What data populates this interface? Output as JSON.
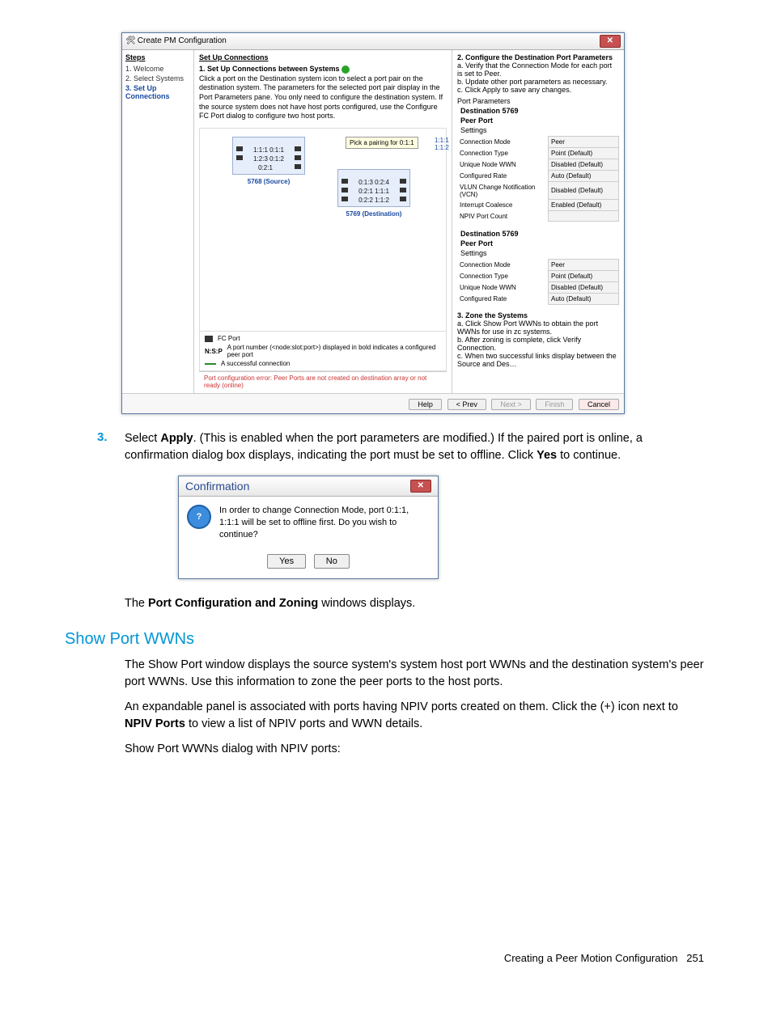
{
  "dialog1": {
    "title": "Create PM Configuration",
    "steps_header": "Steps",
    "steps": [
      "1. Welcome",
      "2. Select Systems",
      "3. Set Up Connections"
    ],
    "main_header": "Set Up Connections",
    "instr_bold": "1. Set Up Connections between Systems",
    "instr_text": "Click a port on the Destination system icon to select a port pair on the destination system. The parameters for the selected port pair display in the Port Parameters pane. You only need to configure the destination system. If the source system does not have host ports configured, use the Configure FC Port dialog to configure two host ports.",
    "source_ports": [
      "1:1:1  0:1:1",
      "1:2:3  0:1:2",
      "0:2:1"
    ],
    "source_caption": "5768 (Source)",
    "dest_ports": [
      "0:1:3  0:2:4",
      "0:2:1  1:1:1",
      "0:2:2  1:1:2"
    ],
    "dest_caption": "5769 (Destination)",
    "tooltip": "Pick a pairing for 0:1:1",
    "pairlist": [
      "1:1:1",
      "1:1:2"
    ],
    "legend1_label": "FC Port",
    "legend2_prefix": "N:S:P",
    "legend2_text": "A port number (<node:slot:port>) displayed in bold indicates a configured peer port",
    "legend3_text": "A successful connection",
    "right_bold": "2. Configure the Destination Port Parameters",
    "right_steps": [
      "a. Verify that the Connection Mode for each port is set to Peer.",
      "b. Update other port parameters as necessary.",
      "c. Click Apply to save any changes."
    ],
    "params_hdr": "Port Parameters",
    "dest_line": "Destination  5769",
    "peer_line": "Peer Port",
    "settings": "Settings",
    "rows1": [
      [
        "Connection Mode",
        "Peer"
      ],
      [
        "Connection Type",
        "Point (Default)"
      ],
      [
        "Unique Node WWN",
        "Disabled (Default)"
      ],
      [
        "Configured Rate",
        "Auto (Default)"
      ],
      [
        "VLUN Change Notification (VCN)",
        "Disabled (Default)"
      ],
      [
        "Interrupt Coalesce",
        "Enabled (Default)"
      ],
      [
        "NPIV Port Count",
        ""
      ]
    ],
    "rows2": [
      [
        "Connection Mode",
        "Peer"
      ],
      [
        "Connection Type",
        "Point (Default)"
      ],
      [
        "Unique Node WWN",
        "Disabled (Default)"
      ],
      [
        "Configured Rate",
        "Auto (Default)"
      ]
    ],
    "zone_bold": "3. Zone the Systems",
    "zone_steps": [
      "a. Click Show Port WWNs to obtain the port WWNs for use in zc systems.",
      "b. After zoning is complete, click Verify Connection.",
      "c. When two successful links display between the Source and Des…"
    ],
    "error": "Port configuration error: Peer Ports are not created on destination array or not ready (online)",
    "buttons": {
      "help": "Help",
      "prev": "< Prev",
      "next": "Next >",
      "finish": "Finish",
      "cancel": "Cancel"
    }
  },
  "step3": {
    "num": "3.",
    "text_a": "Select ",
    "apply": "Apply",
    "text_b": ". (This is enabled when the port parameters are modified.) If the paired port is online, a confirmation dialog box displays, indicating the port must be set to offline. Click ",
    "yes": "Yes",
    "text_c": " to continue."
  },
  "confirm": {
    "title": "Confirmation",
    "body": "In order to change Connection Mode, port 0:1:1, 1:1:1 will be set to offline first. Do you wish to continue?",
    "yes": "Yes",
    "no": "No"
  },
  "after_confirm_a": "The ",
  "after_confirm_bold": "Port Configuration and Zoning",
  "after_confirm_b": " windows displays.",
  "section_title": "Show Port WWNs",
  "section_p1": "The Show Port window displays the source system's system host port WWNs and the destination system's peer port WWNs. Use this information to zone the peer ports to the host ports.",
  "section_p2_a": "An expandable panel is associated with ports having NPIV ports created on them. Click the (+) icon next to ",
  "section_p2_bold": "NPIV Ports",
  "section_p2_b": " to view a list of NPIV ports and WWN details.",
  "section_p3": "Show Port WWNs dialog with NPIV ports:",
  "footer_text": "Creating a Peer Motion Configuration",
  "footer_page": "251"
}
